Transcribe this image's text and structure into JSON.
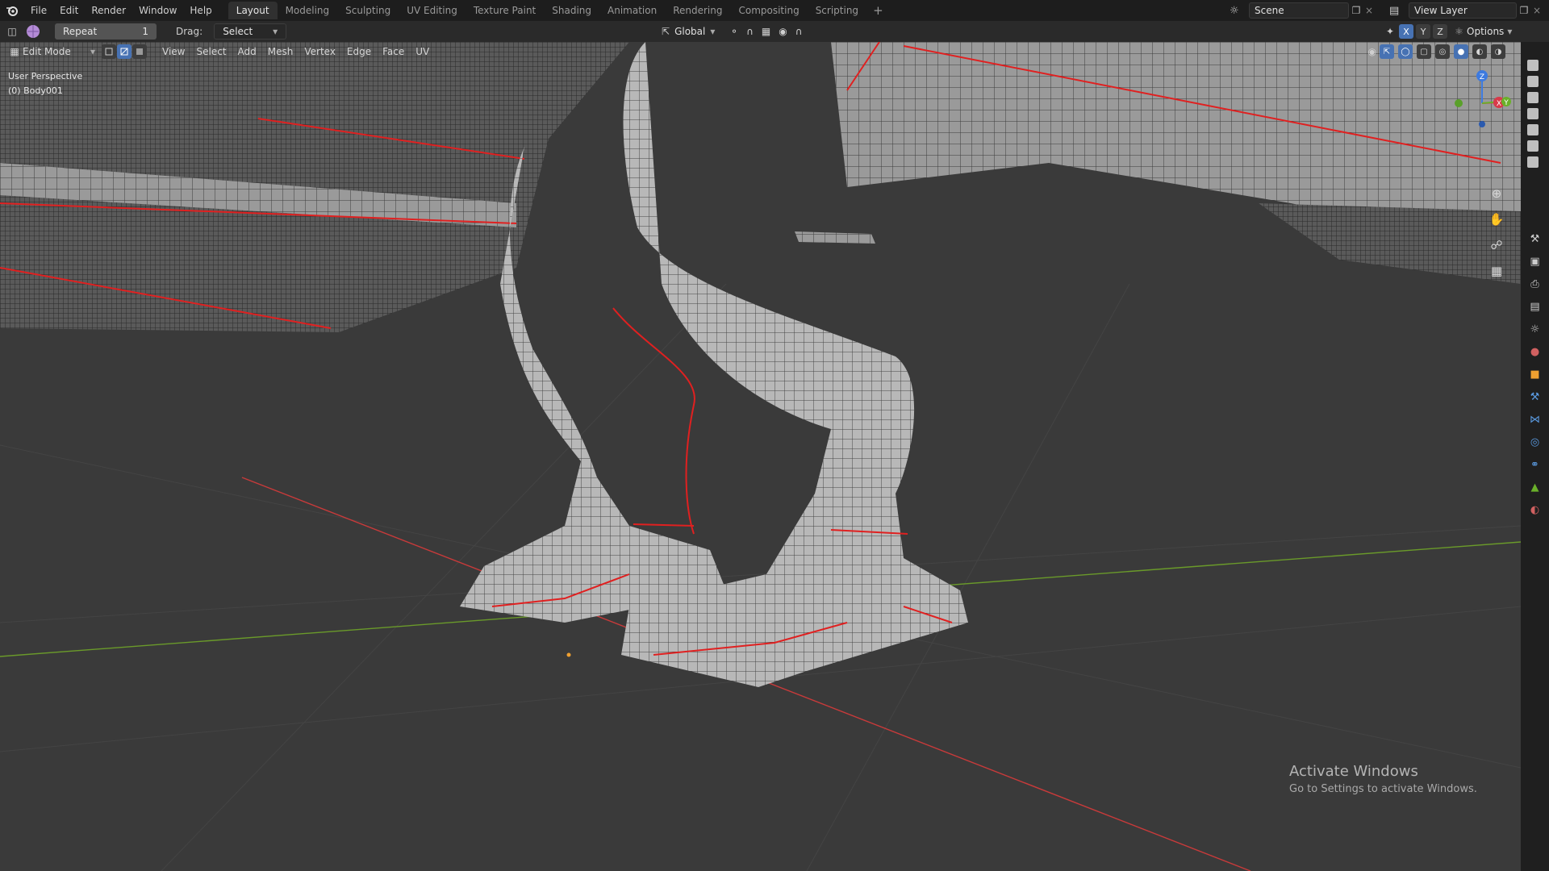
{
  "topbar": {
    "menus": [
      "File",
      "Edit",
      "Render",
      "Window",
      "Help"
    ],
    "workspaces": [
      "Layout",
      "Modeling",
      "Sculpting",
      "UV Editing",
      "Texture Paint",
      "Shading",
      "Animation",
      "Rendering",
      "Compositing",
      "Scripting"
    ],
    "active_workspace": "Layout",
    "add_tab": "+",
    "scene": "Scene",
    "view_layer": "View Layer"
  },
  "toolbar": {
    "repeat_label": "Repeat",
    "repeat_count": "1",
    "drag_label": "Drag:",
    "drag_value": "Select Box",
    "orientation": "Global",
    "options": "Options",
    "axes": [
      "X",
      "Y",
      "Z"
    ]
  },
  "header": {
    "mode": "Edit Mode",
    "menus": [
      "View",
      "Select",
      "Add",
      "Mesh",
      "Vertex",
      "Edge",
      "Face",
      "UV"
    ]
  },
  "viewport": {
    "perspective": "User Perspective",
    "object": "(0) Body001"
  },
  "gizmo": {
    "x": "X",
    "y": "Y",
    "z": "Z"
  },
  "watermark": {
    "title": "Activate Windows",
    "subtitle": "Go to Settings to activate Windows."
  },
  "colors": {
    "accent": "#4772b3",
    "seam": "#e02020",
    "x_axis": "#c83a3a",
    "y_axis": "#6a9a2a"
  }
}
